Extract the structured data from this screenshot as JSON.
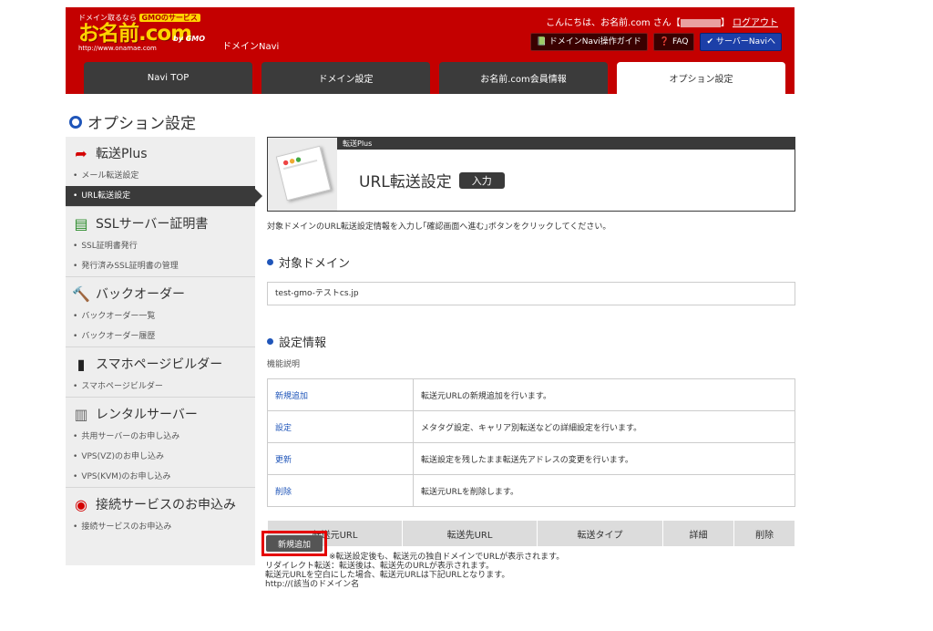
{
  "header": {
    "tagline_prefix": "ドメイン取るなら",
    "tagline_highlight": "GMOのサービス",
    "logo_text": "お名前.com",
    "logo_url": "http://www.onamae.com",
    "logo_gmo": "by GMO",
    "navi_label": "ドメインNavi",
    "greeting_prefix": "こんにちは、お名前.com さん【",
    "greeting_suffix": "】",
    "logout": "ログアウト",
    "buttons": {
      "guide": "ドメインNavi操作ガイド",
      "faq": "FAQ",
      "server_navi": "サーバーNaviへ"
    }
  },
  "tabs": [
    {
      "label": "Navi TOP"
    },
    {
      "label": "ドメイン設定"
    },
    {
      "label": "お名前.com会員情報"
    },
    {
      "label": "オプション設定"
    }
  ],
  "page_title": "オプション設定",
  "sidebar": {
    "sections": [
      {
        "title": "転送Plus",
        "items": [
          "メール転送設定",
          "URL転送設定"
        ]
      },
      {
        "title": "SSLサーバー証明書",
        "items": [
          "SSL証明書発行",
          "発行済みSSL証明書の管理"
        ]
      },
      {
        "title": "バックオーダー",
        "items": [
          "バックオーダー一覧",
          "バックオーダー履歴"
        ]
      },
      {
        "title": "スマホページビルダー",
        "items": [
          "スマホページビルダー"
        ]
      },
      {
        "title": "レンタルサーバー",
        "items": [
          "共用サーバーのお申し込み",
          "VPS(VZ)のお申し込み",
          "VPS(KVM)のお申し込み"
        ]
      },
      {
        "title": "接続サービスのお申込み",
        "items": [
          "接続サービスのお申込み"
        ]
      }
    ]
  },
  "hero": {
    "bar_label": "転送Plus",
    "title": "URL転送設定",
    "badge": "入力"
  },
  "description": "対象ドメインのURL転送設定情報を入力し｢確認画面へ進む｣ボタンをクリックしてください。",
  "target_domain": {
    "title": "対象ドメイン",
    "value": "test-gmo-テストcs.jp"
  },
  "settings": {
    "title": "設定情報",
    "note": "機能説明",
    "rows": [
      {
        "key": "新規追加",
        "value": "転送元URLの新規追加を行います。"
      },
      {
        "key": "設定",
        "value": "メタタグ設定、キャリア別転送などの詳細設定を行います。"
      },
      {
        "key": "更新",
        "value": "転送設定を残したまま転送先アドレスの変更を行います。"
      },
      {
        "key": "削除",
        "value": "転送元URLを削除します。"
      }
    ]
  },
  "list_headers": [
    "転送元URL",
    "転送先URL",
    "転送タイプ",
    "詳細",
    "削除"
  ],
  "new_button": "新規追加",
  "notes": [
    "※転送設定後も、転送元の独自ドメインでURLが表示されます。",
    "リダイレクト転送：転送後は、転送先のURLが表示されます。",
    "転送元URLを空白にした場合、転送元URLは下記URLとなります。",
    "http://(該当のドメイン名"
  ]
}
